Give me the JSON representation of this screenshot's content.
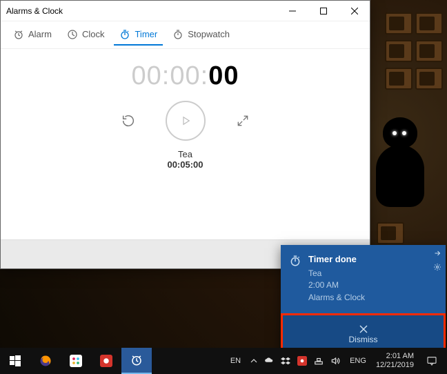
{
  "window": {
    "title": "Alarms & Clock",
    "tabs": {
      "alarm": "Alarm",
      "clock": "Clock",
      "timer": "Timer",
      "stopwatch": "Stopwatch"
    },
    "bigTime": {
      "dim": "00:00:",
      "bold": "00"
    },
    "timer": {
      "name": "Tea",
      "duration": "00:05:00"
    },
    "plus": "+"
  },
  "toast": {
    "title": "Timer done",
    "line1": "Tea",
    "line2": "2:00 AM",
    "source": "Alarms & Clock",
    "dismiss": "Dismiss"
  },
  "taskbar": {
    "langLeft": "EN",
    "langRight": "ENG",
    "time": "2:01 AM",
    "date": "12/21/2019"
  }
}
